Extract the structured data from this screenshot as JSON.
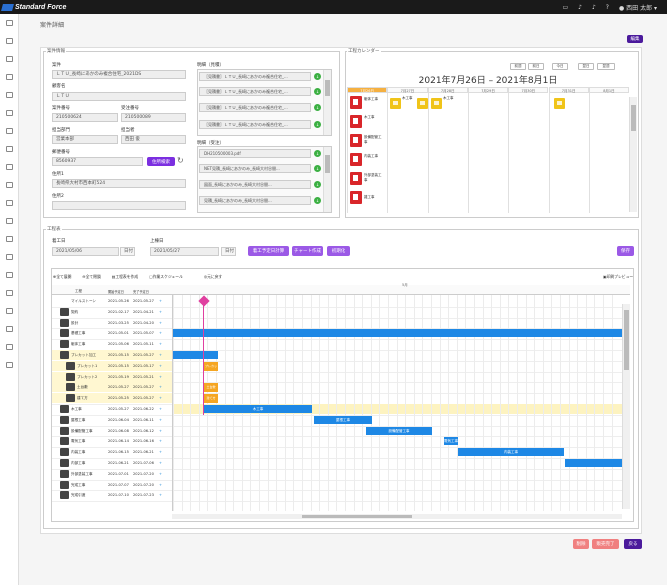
{
  "header": {
    "brand": "Standard Force",
    "user": "西田 太郎"
  },
  "sidebar_icons": [
    "user-icon",
    "clipboard-icon",
    "calendar-icon",
    "truck-icon",
    "document-icon",
    "folder-icon",
    "box-icon",
    "chart-icon",
    "gear-icon",
    "user-icon",
    "building-icon",
    "camera-icon",
    "list-icon",
    "tool-icon",
    "mail-icon",
    "lock-icon",
    "calendar-icon",
    "book-icon",
    "document-icon",
    "folder-icon"
  ],
  "page": {
    "title": "案件詳細",
    "edit_button": "編集"
  },
  "project_info": {
    "section_label": "案件情報",
    "project_name_label": "案件",
    "project_name": "ＬＴＵ_長崎にあかのみ複合住宅_2021DS",
    "customer_label": "顧客名",
    "customer": "ＬＴＵ",
    "project_no_label": "案件番号",
    "project_no": "210500624",
    "order_no_label": "受注番号",
    "order_no": "210500089",
    "dept_label": "担当部門",
    "dept": "営業本部",
    "staff_label": "担当者",
    "staff": "西田 俊",
    "postal_label": "郵便番号",
    "postal": "8560937",
    "postal_button": "住所検索",
    "addr1_label": "住所1",
    "addr1": "長崎県大村市西本町524",
    "addr2_label": "住所2",
    "addr2": ""
  },
  "estimates": {
    "label": "明細（見積）",
    "items": [
      "［見積書］ＬＴＵ_長崎にあかのみ複合住宅_...",
      "［見積書］ＬＴＵ_長崎にあかのみ複合住宅_...",
      "［見積書］ＬＴＵ_長崎にあかのみ複合住宅_...",
      "［見積書］ＬＴＵ_長崎にあかのみ複合住宅_..."
    ]
  },
  "orders": {
    "label": "明細（受注）",
    "items": [
      "DH210500003.pdf",
      "NET見積_長崎にあかのみ_長崎大村谷間...",
      "図面_長崎にあかのみ_長崎大村谷間...",
      "見積_長崎にあかのみ_長崎大村谷間..."
    ]
  },
  "calendar": {
    "section_label": "工程カレンダー",
    "title": "2021年7月26日 – 2021年8月1日",
    "buttons": [
      "前週",
      "前日",
      "今日",
      "翌日",
      "翌週"
    ],
    "days": [
      "7月26日",
      "7月27日",
      "7月28日",
      "7月29日",
      "7月30日",
      "7月31日",
      "8月1日"
    ],
    "left_labels": [
      "躯体工事",
      "木工事",
      "設備配管工事",
      "内装工事",
      "外部塗装工事",
      "雑工事"
    ],
    "event_labels": [
      "木工事",
      "木工事"
    ]
  },
  "schedule": {
    "section_label": "工程表",
    "start_label": "着工日",
    "start_date": "2021/05/06",
    "end_label": "上棟日",
    "end_date": "2021/05/27",
    "day_unit": "日付",
    "buttons": [
      "着工予定日計算",
      "チャート作成",
      "初期化"
    ],
    "save_button": "保存"
  },
  "gantt": {
    "toolbar": [
      "全て展開",
      "全て閉鎖",
      "工程表を作成",
      "作業スケジュール",
      "元に戻す"
    ],
    "toolbar_right": "印刷プレビュー",
    "month_label": "5月",
    "columns": [
      "工程",
      "開始予定日",
      "完了予定日"
    ],
    "rows": [
      {
        "name": "マイルストーン",
        "start": "2021-05-26",
        "end": "2021-05-27"
      },
      {
        "name": "契約",
        "start": "2021-02-17",
        "end": "2021-04-21"
      },
      {
        "name": "設計",
        "start": "2021-03-25",
        "end": "2021-04-20"
      },
      {
        "name": "基礎工事",
        "start": "2021-05-01",
        "end": "2021-05-07"
      },
      {
        "name": "躯体工事",
        "start": "2021-05-06",
        "end": "2021-05-11"
      },
      {
        "name": "プレカット加工",
        "start": "2021-05-15",
        "end": "2021-05-27"
      },
      {
        "name": "プレカット1",
        "start": "2021-05-15",
        "end": "2021-05-17"
      },
      {
        "name": "プレカット2",
        "start": "2021-05-19",
        "end": "2021-05-21"
      },
      {
        "name": "土台敷",
        "start": "2021-05-27",
        "end": "2021-05-27"
      },
      {
        "name": "建て方",
        "start": "2021-05-25",
        "end": "2021-05-27"
      },
      {
        "name": "木工事",
        "start": "2021-05-27",
        "end": "2021-06-22"
      },
      {
        "name": "屋根工事",
        "start": "2021-06-04",
        "end": "2021-06-11"
      },
      {
        "name": "設備配管工事",
        "start": "2021-06-08",
        "end": "2021-06-12"
      },
      {
        "name": "電気工事",
        "start": "2021-06-14",
        "end": "2021-06-16"
      },
      {
        "name": "内装工事",
        "start": "2021-06-15",
        "end": "2021-06-21"
      },
      {
        "name": "内部工事",
        "start": "2021-06-21",
        "end": "2021-07-06"
      },
      {
        "name": "外部塗装工事",
        "start": "2021-07-01",
        "end": "2021-07-20"
      },
      {
        "name": "完成工事",
        "start": "2021-07-07",
        "end": "2021-07-20"
      },
      {
        "name": "完成引渡",
        "start": "2021-07-10",
        "end": "2021-07-23"
      }
    ],
    "bar_labels": [
      "木工事",
      "屋根工事",
      "設備配管工事",
      "電気工事",
      "内装工事"
    ],
    "orange_labels": [
      "プレカット",
      "土台敷",
      "建て方"
    ]
  },
  "footer": {
    "delete_button": "削除",
    "cancel_button": "販売完了",
    "back_button": "戻る"
  },
  "colors": {
    "accent": "#7b2fe0",
    "bar": "#1e88e5",
    "milestone": "#e040a0",
    "highlight": "#fdf3c0"
  }
}
